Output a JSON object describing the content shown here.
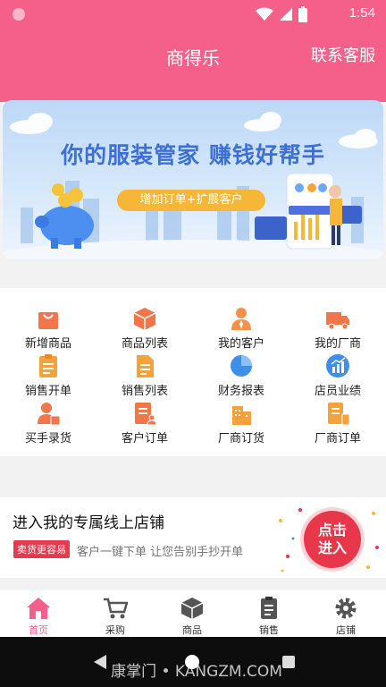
{
  "status_bar": {
    "time": "1:54"
  },
  "header": {
    "title": "商得乐",
    "support_label": "联系客服"
  },
  "banner": {
    "headline": "你的服装管家 赚钱好帮手",
    "pill": "增加订单+扩展客户"
  },
  "menu": [
    {
      "label": "新增商品",
      "icon": "shopping-bag-icon"
    },
    {
      "label": "商品列表",
      "icon": "box-icon"
    },
    {
      "label": "我的客户",
      "icon": "person-icon"
    },
    {
      "label": "我的厂商",
      "icon": "truck-icon"
    },
    {
      "label": "销售开单",
      "icon": "clipboard-icon"
    },
    {
      "label": "销售列表",
      "icon": "document-list-icon"
    },
    {
      "label": "财务报表",
      "icon": "pie-chart-icon"
    },
    {
      "label": "店员业绩",
      "icon": "trend-chart-icon"
    },
    {
      "label": "买手录货",
      "icon": "buyer-icon"
    },
    {
      "label": "客户订单",
      "icon": "customer-order-icon"
    },
    {
      "label": "厂商订货",
      "icon": "building-icon"
    },
    {
      "label": "厂商订单",
      "icon": "vendor-order-icon"
    }
  ],
  "store": {
    "title": "进入我的专属线上店铺",
    "tag": "卖货更容易",
    "subtitle": "客户一键下单 让您告别手抄开单",
    "button_line1": "点击",
    "button_line2": "进入"
  },
  "tabs": [
    {
      "label": "首页",
      "icon": "home-icon",
      "active": true
    },
    {
      "label": "采购",
      "icon": "cart-icon",
      "active": false
    },
    {
      "label": "商品",
      "icon": "box-icon",
      "active": false
    },
    {
      "label": "销售",
      "icon": "clipboard-icon",
      "active": false
    },
    {
      "label": "店铺",
      "icon": "gear-icon",
      "active": false
    }
  ],
  "watermark": "康掌门 • KANGZM.COM",
  "colors": {
    "brand_pink": "#f4608a",
    "orange": "#f2924a",
    "blue": "#3f8fe8",
    "red": "#e8364a"
  }
}
